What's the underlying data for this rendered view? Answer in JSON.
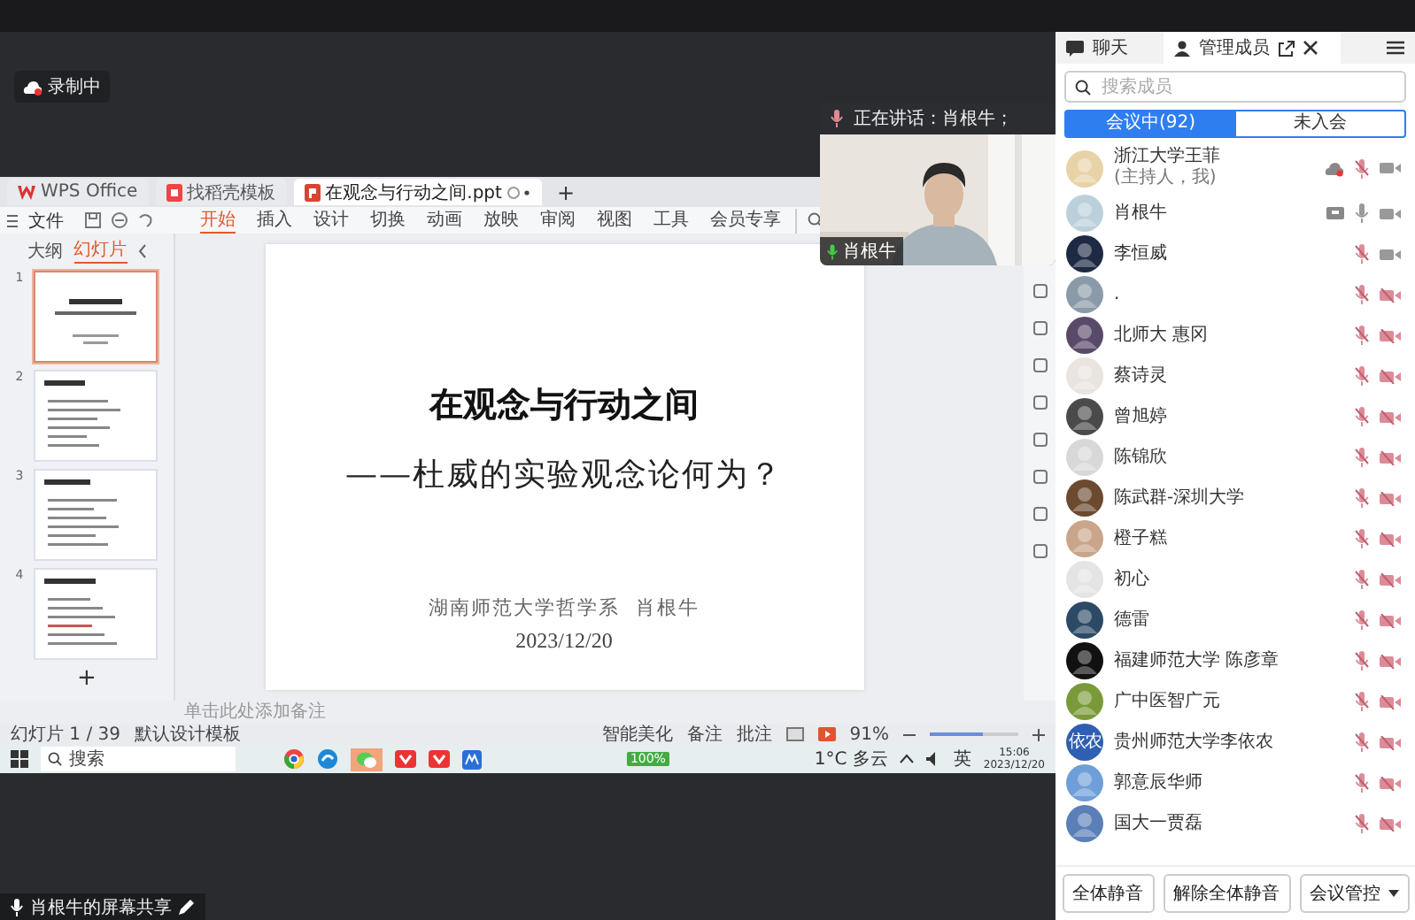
{
  "recording_badge": {
    "label": "录制中"
  },
  "speaker_tile": {
    "status": "正在讲话：肖根牛；",
    "name": "肖根牛",
    "mic_on": true
  },
  "wps": {
    "tabs": [
      {
        "label": "WPS Office",
        "kind": "home",
        "selected": false
      },
      {
        "label": "找稻壳模板",
        "kind": "template",
        "selected": false
      },
      {
        "label": "在观念与行动之间.ppt",
        "kind": "doc",
        "selected": true
      }
    ],
    "new_tab": "+",
    "file_menu": "文件",
    "ribbon_tabs": [
      {
        "label": "开始",
        "selected": true
      },
      {
        "label": "插入",
        "selected": false
      },
      {
        "label": "设计",
        "selected": false
      },
      {
        "label": "切换",
        "selected": false
      },
      {
        "label": "动画",
        "selected": false
      },
      {
        "label": "放映",
        "selected": false
      },
      {
        "label": "审阅",
        "selected": false
      },
      {
        "label": "视图",
        "selected": false
      },
      {
        "label": "工具",
        "selected": false
      },
      {
        "label": "会员专享",
        "selected": false
      }
    ],
    "pane_tabs": [
      {
        "label": "大纲",
        "selected": false
      },
      {
        "label": "幻灯片",
        "selected": true
      }
    ],
    "thumbnails": [
      {
        "number": "1",
        "selected": true
      },
      {
        "number": "2",
        "selected": false
      },
      {
        "number": "3",
        "selected": false
      },
      {
        "number": "4",
        "selected": false
      }
    ],
    "add_slide": "+",
    "slide": {
      "title": "在观念与行动之间",
      "subtitle": "——杜威的实验观念论何为？",
      "author": "湖南师范大学哲学系  肖根牛",
      "date": "2023/12/20"
    },
    "notes_placeholder": "单击此处添加备注",
    "status": {
      "slide_counter": "幻灯片 1 / 39",
      "template": "默认设计模板",
      "beautify": "智能美化",
      "notes": "备注",
      "comments": "批注",
      "zoom": "91%",
      "zoom_slider": {
        "level": 0.6
      }
    }
  },
  "taskbar": {
    "search_placeholder": "搜索",
    "battery": "100%",
    "weather": "1°C 多云",
    "ime": "英",
    "time": "15:06",
    "date": "2023/12/20"
  },
  "share_label": "肖根牛的屏幕共享",
  "panel": {
    "tabs": [
      {
        "label": "聊天",
        "selected": false
      },
      {
        "label": "管理成员",
        "selected": true
      }
    ],
    "search": {
      "placeholder": "搜索成员"
    },
    "segments": [
      {
        "label": "会议中(92)",
        "selected": true
      },
      {
        "label": "未入会",
        "selected": false
      }
    ],
    "members": [
      {
        "name": "浙江大学王菲",
        "note": "(主持人，我)",
        "mic_on": false,
        "video_on": true,
        "kind": "recording"
      },
      {
        "name": "肖根牛",
        "mic_on": true,
        "video_on": true,
        "kind": "sharing"
      },
      {
        "name": "李恒威",
        "mic_on": false,
        "video_on": true
      },
      {
        "name": ".",
        "mic_on": false,
        "video_on": false
      },
      {
        "name": "北师大 惠冈",
        "mic_on": false,
        "video_on": false
      },
      {
        "name": "蔡诗灵",
        "mic_on": false,
        "video_on": false
      },
      {
        "name": "曾旭婷",
        "mic_on": false,
        "video_on": false
      },
      {
        "name": "陈锦欣",
        "mic_on": false,
        "video_on": false
      },
      {
        "name": "陈武群-深圳大学",
        "mic_on": false,
        "video_on": false
      },
      {
        "name": "橙子糕",
        "mic_on": false,
        "video_on": false
      },
      {
        "name": "初心",
        "mic_on": false,
        "video_on": false
      },
      {
        "name": "德雷",
        "mic_on": false,
        "video_on": false
      },
      {
        "name": "福建师范大学 陈彦章",
        "mic_on": false,
        "video_on": false
      },
      {
        "name": "广中医智广元",
        "mic_on": false,
        "video_on": false
      },
      {
        "name": "贵州师范大学李依农",
        "avatar_text": "依农",
        "mic_on": false,
        "video_on": false
      },
      {
        "name": "郭意辰华师",
        "mic_on": false,
        "video_on": false
      },
      {
        "name": "国大一贾磊",
        "mic_on": false,
        "video_on": false
      }
    ],
    "buttons": [
      "全体静音",
      "解除全体静音",
      "会议管控"
    ]
  }
}
